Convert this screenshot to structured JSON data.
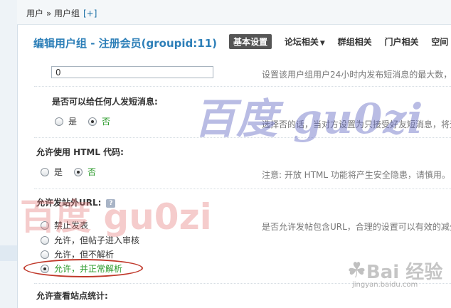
{
  "breadcrumb": {
    "text": "用户 » 用户组",
    "add": "[+]"
  },
  "header": {
    "title": "编辑用户组 - 注册会员(groupid:11)",
    "tabs": [
      {
        "label": "基本设置",
        "active": true
      },
      {
        "label": "论坛相关",
        "dropdown": true
      },
      {
        "label": "群组相关"
      },
      {
        "label": "门户相关"
      },
      {
        "label": "空间"
      }
    ]
  },
  "settings": {
    "pm_limit": {
      "value": "0",
      "desc": "设置该用户组用户24小时内发布短消息的最大数，"
    },
    "pm_any": {
      "label": "是否可以给任何人发短消息:",
      "options": [
        "是",
        "否"
      ],
      "selected": "否",
      "desc": "选择否的话，当对方设置为只接受好友短消息，将无"
    },
    "allow_html": {
      "label": "允许使用 HTML 代码:",
      "options": [
        "是",
        "否"
      ],
      "selected": "否",
      "desc": "注意: 开放 HTML 功能将产生安全隐患，请慎用。"
    },
    "allow_url": {
      "label": "允许发站外URL:",
      "help": "?",
      "options": [
        "禁止发表",
        "允许，但帖子进入审核",
        "允许，但不解析",
        "允许，并正常解析"
      ],
      "selected": "允许，并正常解析",
      "desc": "是否允许发帖包含URL，合理的设置可以有效的减少"
    },
    "view_stats": {
      "label": "允许查看站点统计:"
    }
  },
  "watermarks": {
    "top": "百度 gu0zi",
    "middle": "百度 gu0zi",
    "brand_logo": "Bai 经验",
    "brand_url": "jingyan.baidu.com"
  },
  "colors": {
    "accent": "#2d7fb8",
    "selected": "#2a9a2a",
    "highlight_oval": "#c0392b"
  }
}
